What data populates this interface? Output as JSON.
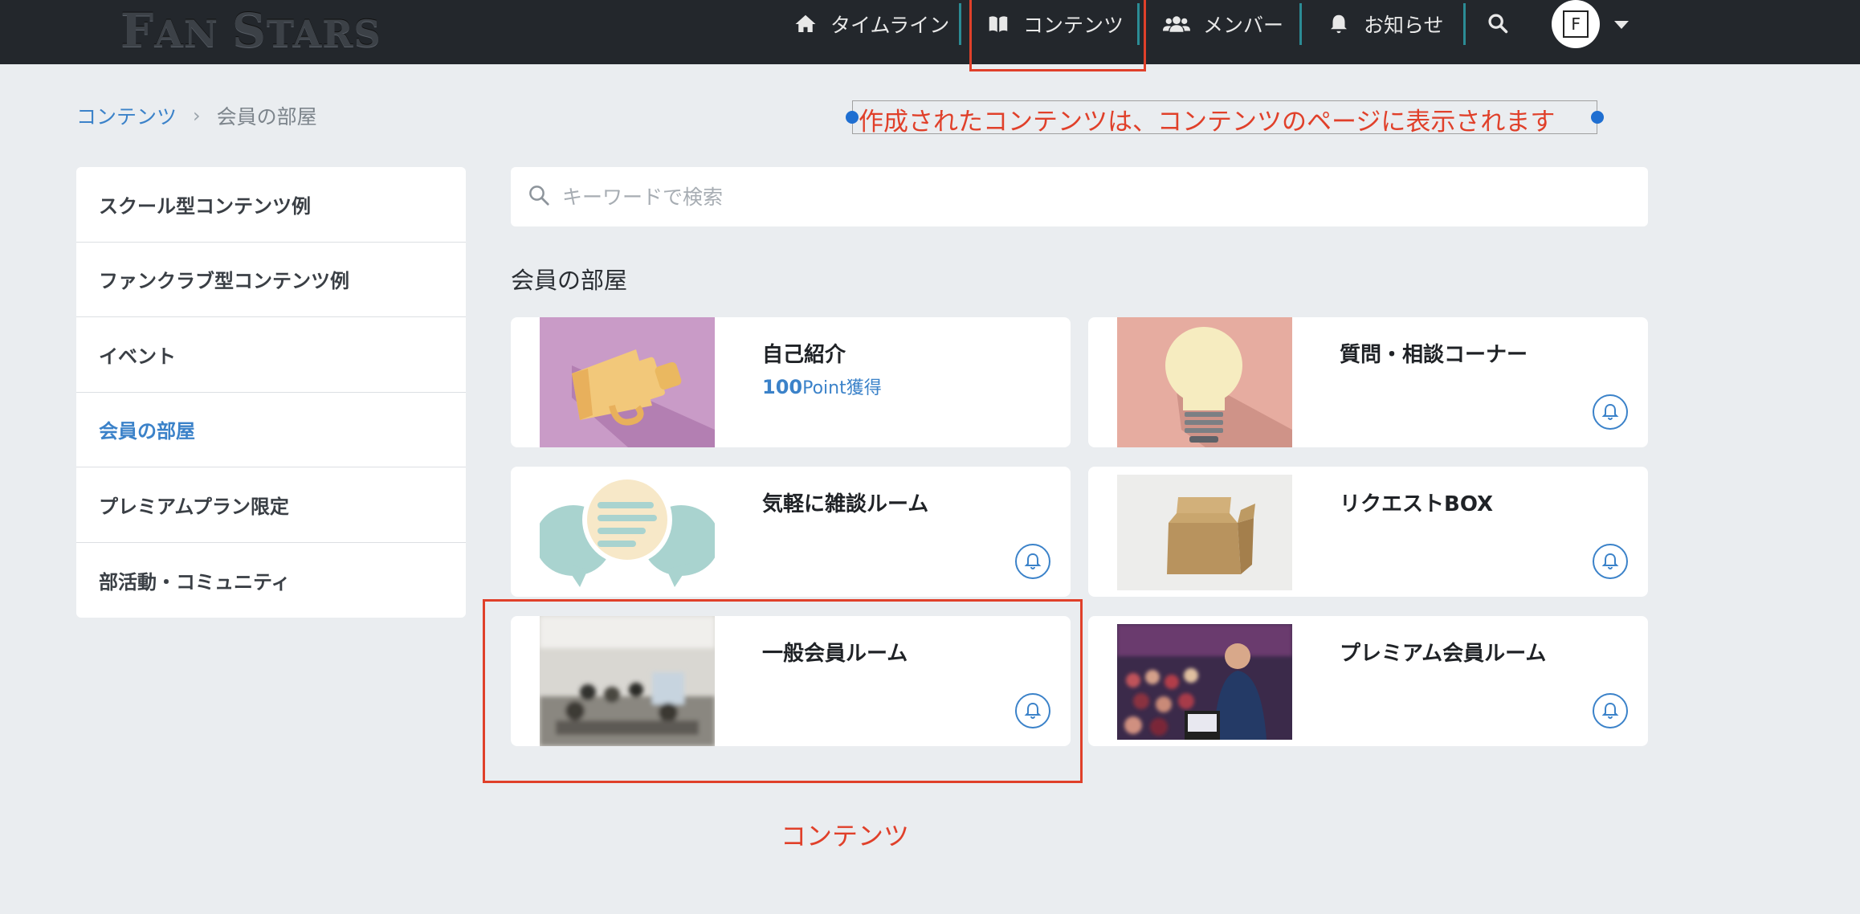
{
  "header": {
    "logo": "FAN STARS",
    "nav": [
      {
        "label": "タイムライン",
        "icon": "home-icon"
      },
      {
        "label": "コンテンツ",
        "icon": "book-icon"
      },
      {
        "label": "メンバー",
        "icon": "users-icon"
      },
      {
        "label": "お知らせ",
        "icon": "bell-icon"
      }
    ],
    "search_icon": "search-icon",
    "avatar_letter": "F"
  },
  "breadcrumb": {
    "root": "コンテンツ",
    "separator": "›",
    "current": "会員の部屋"
  },
  "annotation_top": "作成されたコンテンツは、コンテンツのページに表示されます",
  "annotation_bottom": "コンテンツ",
  "sidebar": {
    "items": [
      {
        "label": "スクール型コンテンツ例",
        "active": false
      },
      {
        "label": "ファンクラブ型コンテンツ例",
        "active": false
      },
      {
        "label": "イベント",
        "active": false
      },
      {
        "label": "会員の部屋",
        "active": true
      },
      {
        "label": "プレミアムプラン限定",
        "active": false
      },
      {
        "label": "部活動・コミュニティ",
        "active": false
      }
    ]
  },
  "search": {
    "placeholder": "キーワードで検索"
  },
  "section_title": "会員の部屋",
  "cards": [
    {
      "title": "自己紹介",
      "points": "100",
      "points_unit": "Point獲得",
      "image": "megaphone-illustration"
    },
    {
      "title": "質問・相談コーナー",
      "image": "lightbulb-illustration"
    },
    {
      "title": "気軽に雑談ルーム",
      "image": "speech-bubbles-illustration"
    },
    {
      "title": "リクエストBOX",
      "image": "cardboard-box-photo"
    },
    {
      "title": "一般会員ルーム",
      "image": "meeting-room-photo"
    },
    {
      "title": "プレミアム会員ルーム",
      "image": "conference-speaker-photo"
    }
  ],
  "colors": {
    "accent": "#3b82c9",
    "annotation": "#e0402a",
    "header_bg": "#23272c",
    "page_bg": "#eaedf0"
  }
}
